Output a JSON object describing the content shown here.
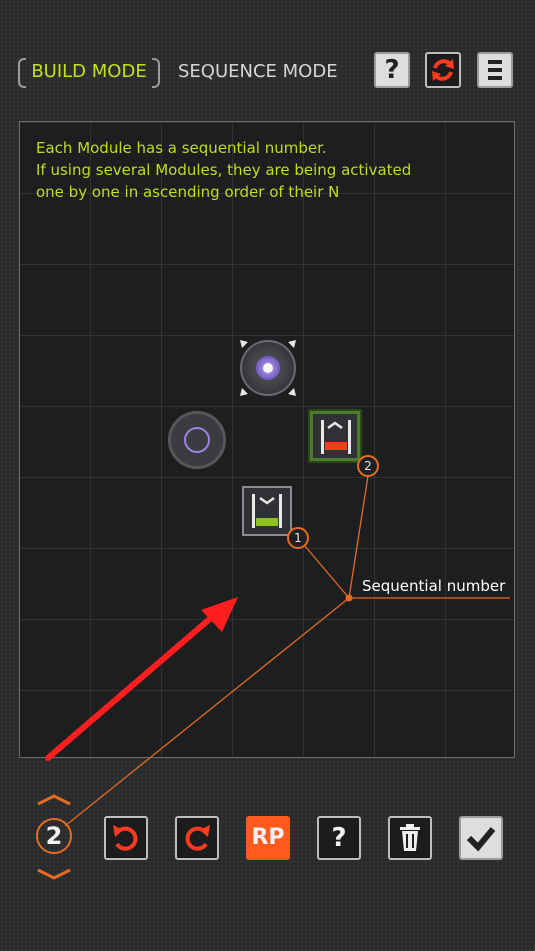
{
  "header": {
    "build_mode_label": "BUILD MODE",
    "sequence_mode_label": "SEQUENCE MODE",
    "help_label": "?"
  },
  "board": {
    "hint_text": "Each Module has a sequential number.\nIf using several Modules, they are being activated\none by one in ascending order of their N",
    "modules": [
      {
        "name": "eye-module",
        "selected": false
      },
      {
        "name": "ring-module",
        "selected": false
      },
      {
        "name": "red-container-module",
        "sequence_number": "2",
        "selected": true
      },
      {
        "name": "green-container-module",
        "sequence_number": "1",
        "selected": false
      }
    ],
    "callout_label": "Sequential number"
  },
  "toolbar": {
    "sequence_value": "2",
    "rp_label": "RP",
    "help_label": "?"
  },
  "icons": [
    "help-icon",
    "refresh-icon",
    "menu-icon",
    "chevron-up-icon",
    "chevron-down-icon",
    "rotate-left-icon",
    "rotate-right-icon",
    "trash-icon",
    "checkmark-icon"
  ],
  "colors": {
    "accent_green": "#c3dc1e",
    "accent_orange": "#e66b1f",
    "rp_button": "#ff5a1e",
    "arrow_red": "#ff1e1e",
    "ring_purple": "#9f82e0"
  }
}
